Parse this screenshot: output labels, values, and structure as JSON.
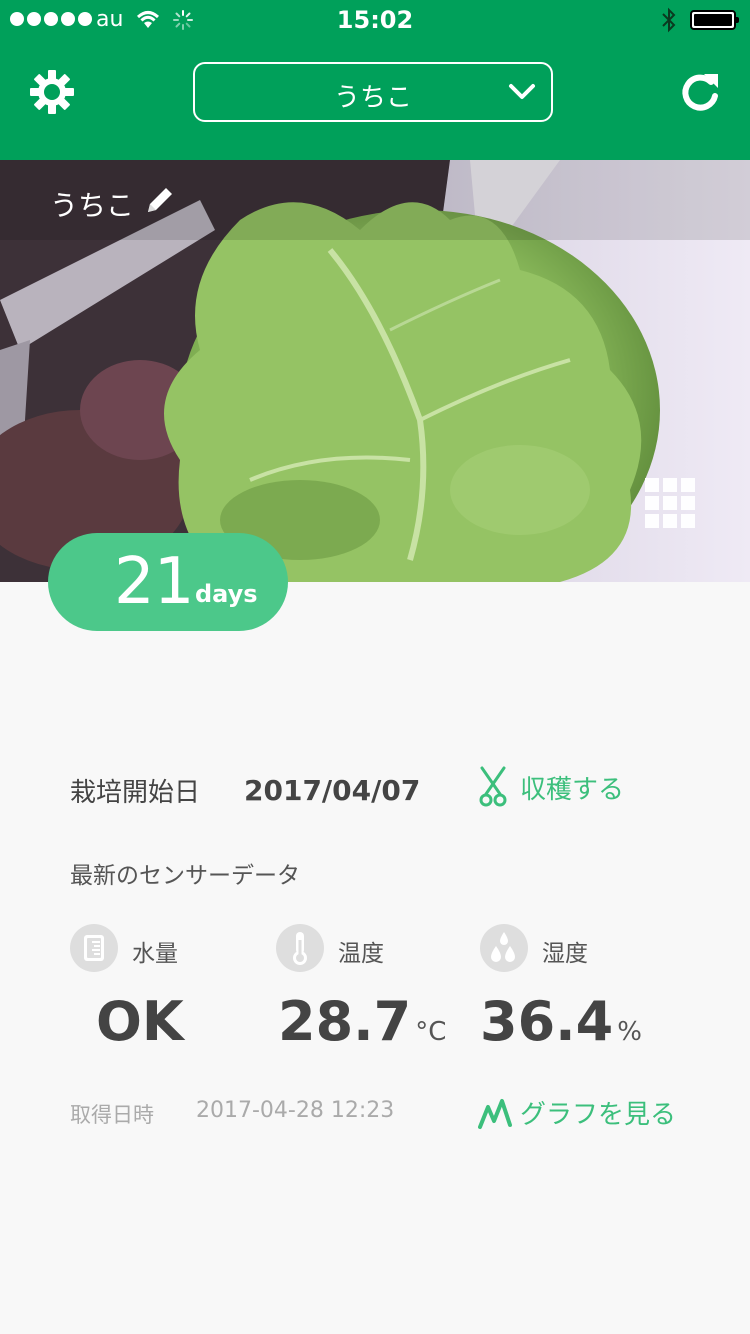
{
  "status_bar": {
    "carrier": "au",
    "time": "15:02"
  },
  "nav": {
    "selected_device": "うちこ",
    "icons": [
      "gear-icon",
      "chevron-down-icon",
      "refresh-icon"
    ]
  },
  "photo": {
    "plant_name": "うちこ",
    "icons": [
      "pencil-icon",
      "grid-icon"
    ]
  },
  "days": {
    "count": "21",
    "unit": "days"
  },
  "info": {
    "start_label": "栽培開始日",
    "start_date": "2017/04/07",
    "harvest_label": "収穫する",
    "sensor_title": "最新のセンサーデータ"
  },
  "sensors": {
    "water": {
      "label": "水量",
      "value": "OK",
      "unit": ""
    },
    "temperature": {
      "label": "温度",
      "value": "28.7",
      "unit": "°C"
    },
    "humidity": {
      "label": "湿度",
      "value": "36.4",
      "unit": "%"
    }
  },
  "acquired": {
    "label": "取得日時",
    "time": "2017-04-28 12:23"
  },
  "graph_label": "グラフを見る",
  "colors": {
    "brand_green": "#00a05a",
    "accent_green": "#4cc88a",
    "link_green": "#3cbf7c"
  }
}
